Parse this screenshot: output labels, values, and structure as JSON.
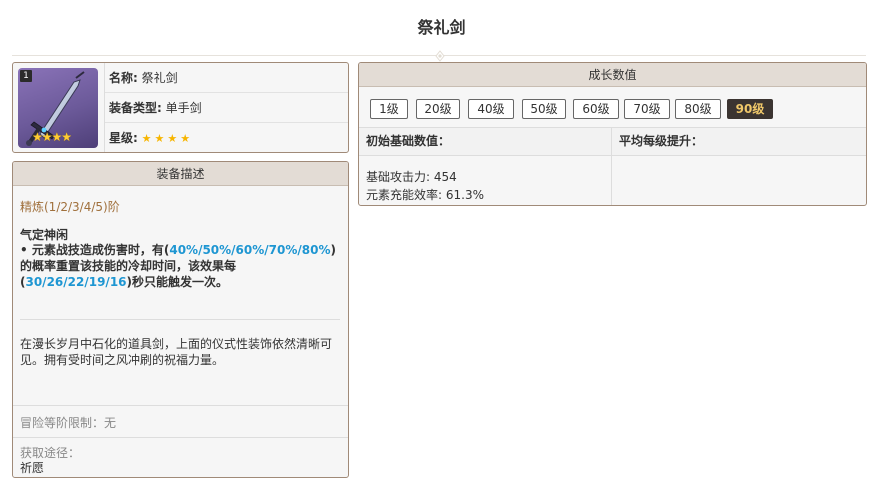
{
  "page": {
    "title": "祭礼剑"
  },
  "info": {
    "badge": "1",
    "name_label": "名称:",
    "name_value": "祭礼剑",
    "type_label": "装备类型:",
    "type_value": "单手剑",
    "rarity_label": "星级:",
    "rarity_stars": "★★★★",
    "rarity_count": 4
  },
  "description": {
    "header": "装备描述",
    "refine": "精炼(1/2/3/4/5)阶",
    "passive_name": "气定神闲",
    "passive_text_1": "• 元素战技造成伤害时，有(",
    "passive_hl_1": "40%/50%/60%/70%/80%",
    "passive_text_2": ")的概率重置该技能的冷却时间，该效果每(",
    "passive_hl_2": "30/26/22/19/16",
    "passive_text_3": ")秒只能触发一次。",
    "lore": "在漫长岁月中石化的道具剑，上面的仪式性装饰依然清晰可见。拥有受时间之风冲刷的祝福力量。",
    "ascension_limit": "冒险等阶限制：无",
    "source_label": "获取途径：",
    "source_value": "祈愿"
  },
  "growth": {
    "header": "成长数值",
    "levels": [
      "1级",
      "20级",
      "40级",
      "50级",
      "60级",
      "70级",
      "80级",
      "90级"
    ],
    "active_level": "90级",
    "base_header": "初始基础数值：",
    "avg_header": "平均每级提升：",
    "stats": [
      "基础攻击力: 454",
      "元素充能效率: 61.3%"
    ]
  },
  "colors": {
    "accent_highlight": "#1e96d2",
    "refine_text": "#a0703c",
    "active_level_bg": "#3b3431",
    "active_level_text": "#f0c86a",
    "panel_header": "#e3dcd5",
    "star": "#f7b500"
  }
}
